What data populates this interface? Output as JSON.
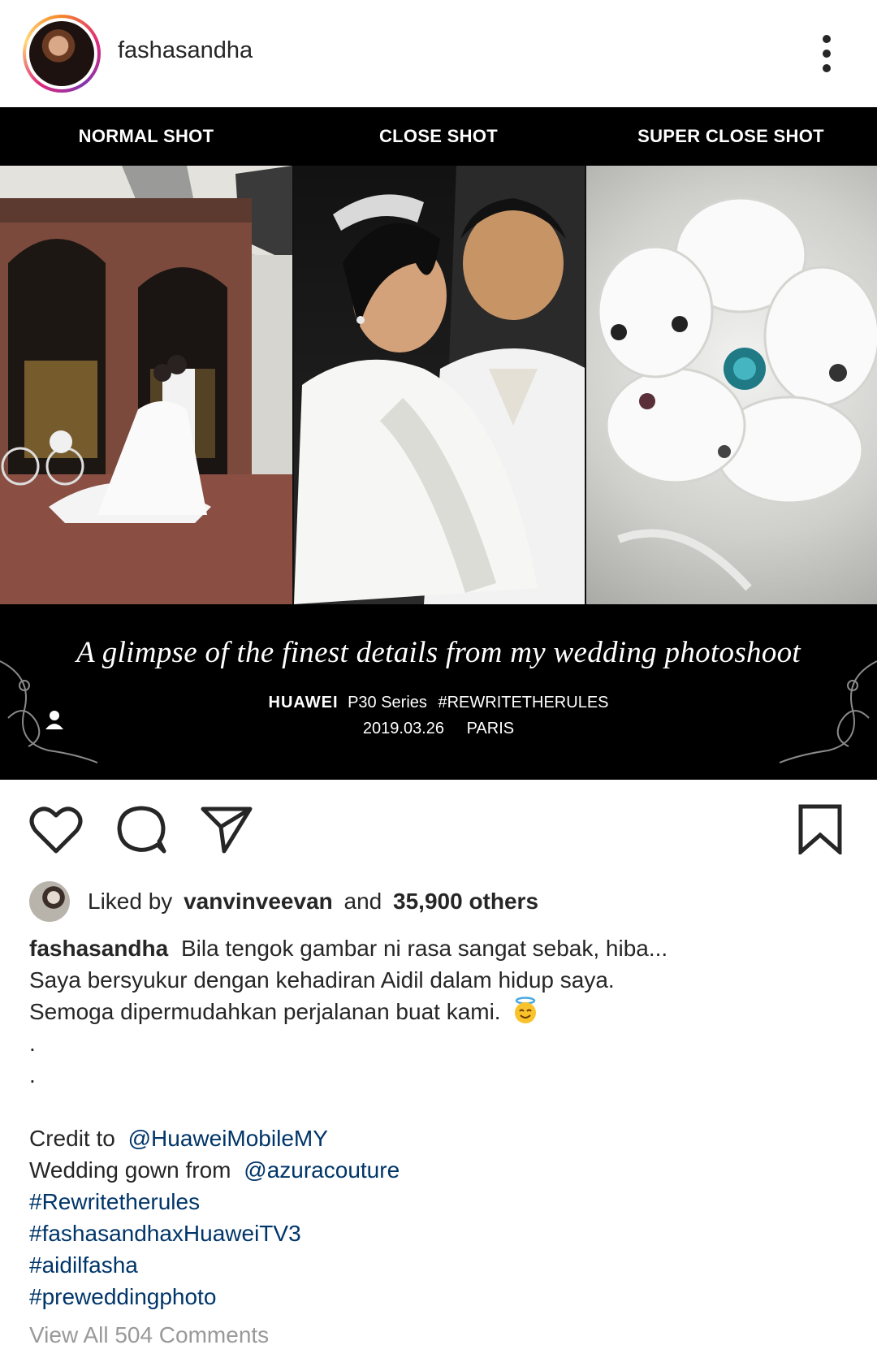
{
  "post": {
    "username": "fashasandha",
    "menu_icon": "more-vertical-icon"
  },
  "media": {
    "shot_labels": [
      "NORMAL SHOT",
      "CLOSE SHOT",
      "SUPER CLOSE SHOT"
    ],
    "tagline": "A glimpse of the finest details from my wedding photoshoot",
    "brand": "HUAWEI",
    "series": "P30 Series",
    "hashtag": "#REWRITETHERULES",
    "date": "2019.03.26",
    "place": "PARIS"
  },
  "actions": {
    "like_icon": "heart-icon",
    "comment_icon": "comment-icon",
    "share_icon": "send-icon",
    "save_icon": "bookmark-icon"
  },
  "likes": {
    "prefix": "Liked by",
    "user": "vanvinveevan",
    "and": "and",
    "count": "35,900 others"
  },
  "caption": {
    "author": "fashasandha",
    "line1": "Bila tengok gambar ni rasa sangat sebak, hiba...",
    "line2": "Saya bersyukur dengan kehadiran Aidil dalam hidup saya.",
    "line3": "Semoga dipermudahkan perjalanan buat kami.",
    "dot": ".",
    "credit_prefix": "Credit to",
    "credit_user": "@HuaweiMobileMY",
    "gown_prefix": "Wedding gown from",
    "gown_user": "@azuracouture",
    "tags": [
      "#Rewritetherules",
      "#fashasandhaxHuaweiTV3",
      "#aidilfasha",
      "#preweddingphoto"
    ]
  },
  "comments": {
    "view_all": "View All 504 Comments"
  },
  "colors": {
    "text": "#262626",
    "link": "#003569",
    "muted": "#999999",
    "media_bg": "#000000"
  }
}
